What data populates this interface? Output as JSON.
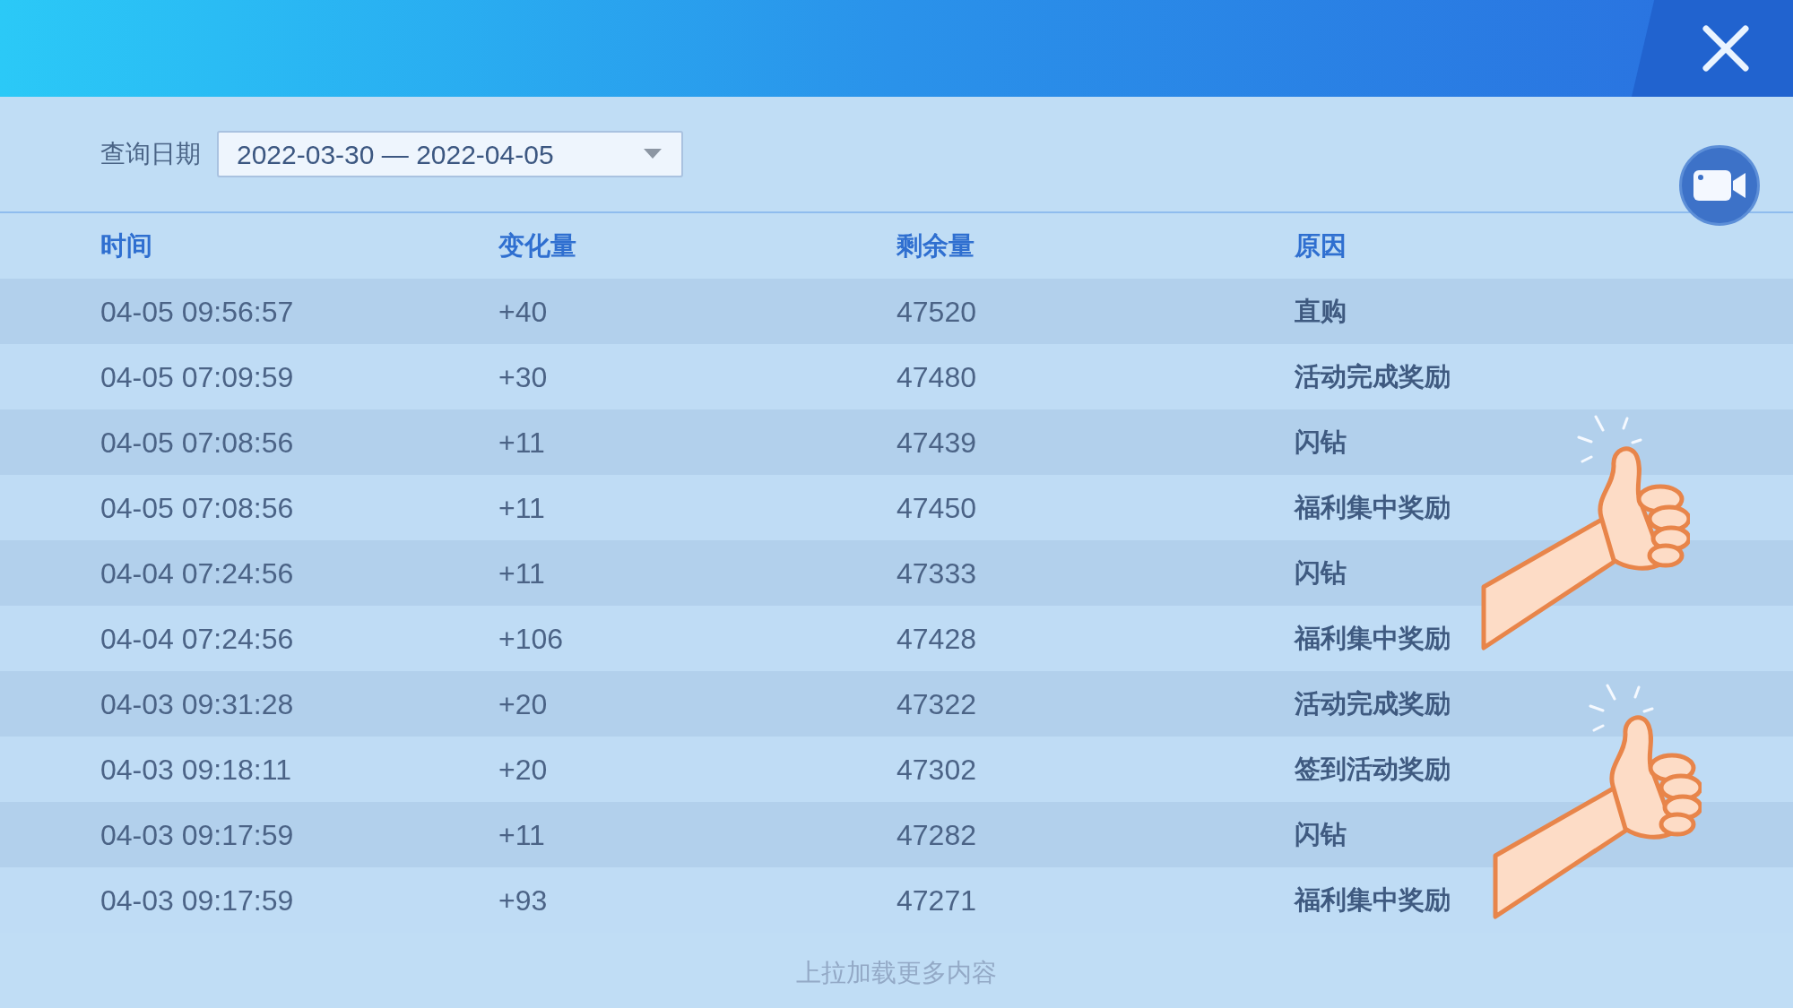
{
  "date_filter": {
    "label": "查询日期",
    "value": "2022-03-30 — 2022-04-05"
  },
  "table": {
    "columns": [
      "时间",
      "变化量",
      "剩余量",
      "原因"
    ],
    "rows": [
      [
        "04-05 09:56:57",
        "+40",
        "47520",
        "直购"
      ],
      [
        "04-05 07:09:59",
        "+30",
        "47480",
        "活动完成奖励"
      ],
      [
        "04-05 07:08:56",
        "+11",
        "47439",
        "闪钻"
      ],
      [
        "04-05 07:08:56",
        "+11",
        "47450",
        "福利集中奖励"
      ],
      [
        "04-04 07:24:56",
        "+11",
        "47333",
        "闪钻"
      ],
      [
        "04-04 07:24:56",
        "+106",
        "47428",
        "福利集中奖励"
      ],
      [
        "04-03 09:31:28",
        "+20",
        "47322",
        "活动完成奖励"
      ],
      [
        "04-03 09:18:11",
        "+20",
        "47302",
        "签到活动奖励"
      ],
      [
        "04-03 09:17:59",
        "+11",
        "47282",
        "闪钻"
      ],
      [
        "04-03 09:17:59",
        "+93",
        "47271",
        "福利集中奖励"
      ]
    ]
  },
  "footer_hint": "上拉加载更多内容"
}
